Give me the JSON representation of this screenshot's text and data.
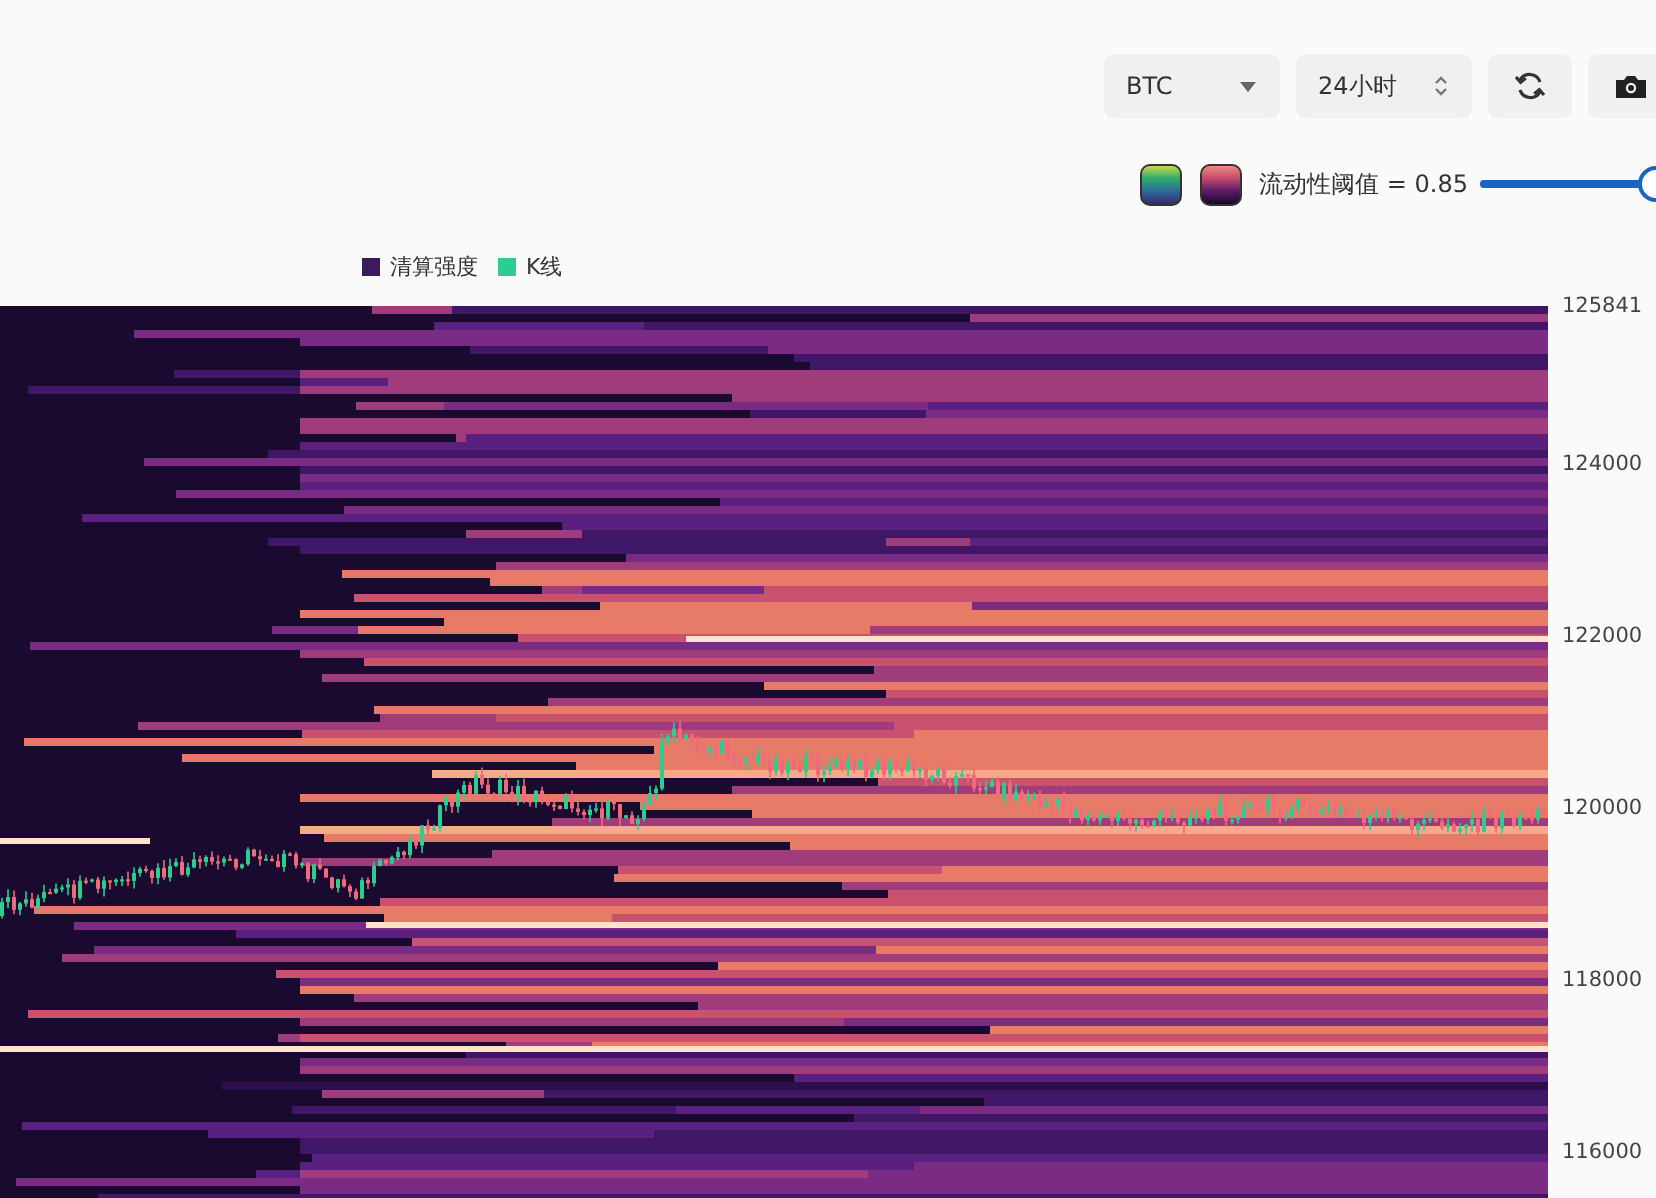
{
  "toolbar": {
    "symbol_select": {
      "value": "BTC"
    },
    "period_select": {
      "value": "24小时"
    }
  },
  "controls": {
    "threshold_label": "流动性阈值 = 0.85",
    "threshold_slider": {
      "level": 0.88
    }
  },
  "legend": [
    {
      "label": "清算强度",
      "color": "#3b1a5e"
    },
    {
      "label": "K线",
      "color": "#2ecc8f"
    }
  ],
  "chart": {
    "y_axis_labels": [
      "125841",
      "124000",
      "122000",
      "120000",
      "118000",
      "116000"
    ]
  }
}
